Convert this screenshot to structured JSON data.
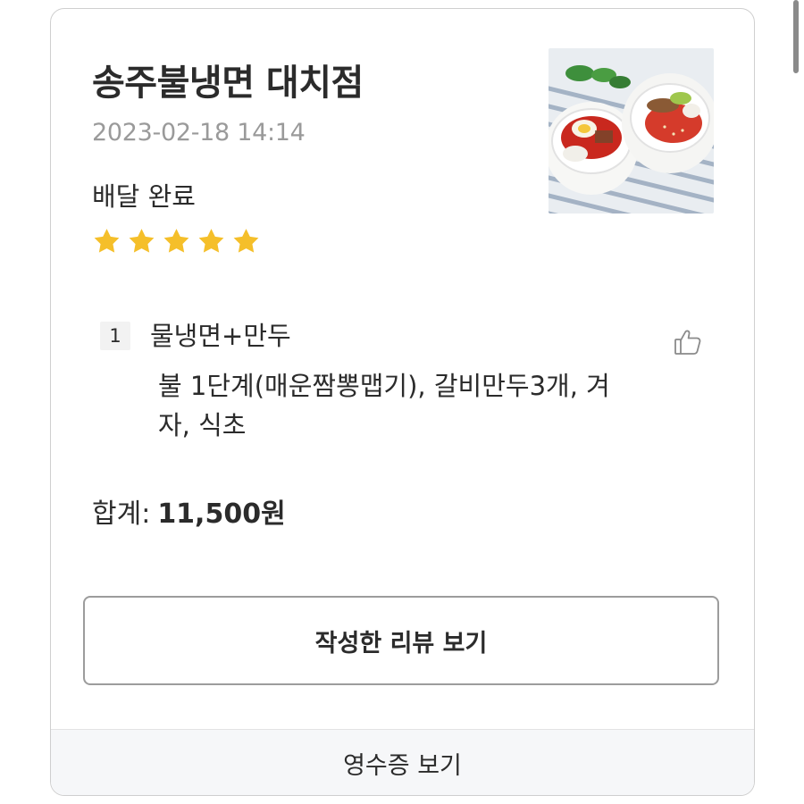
{
  "order": {
    "store_name": "송주불냉면 대치점",
    "date": "2023-02-18 14:14",
    "status": "배달 완료",
    "rating": 5,
    "rating_max": 5,
    "star_color": "#f5bf2a"
  },
  "items": [
    {
      "index": "1",
      "name": "물냉면+만두",
      "options": "불 1단계(매운짬뽕맵기), 갈비만두3개, 겨자, 식초"
    }
  ],
  "total": {
    "label": "합계:",
    "value": "11,500원"
  },
  "actions": {
    "review_button": "작성한 리뷰 보기",
    "receipt_button": "영수증 보기"
  },
  "icons": {
    "like": "thumbs-up-icon",
    "star": "star-icon"
  }
}
